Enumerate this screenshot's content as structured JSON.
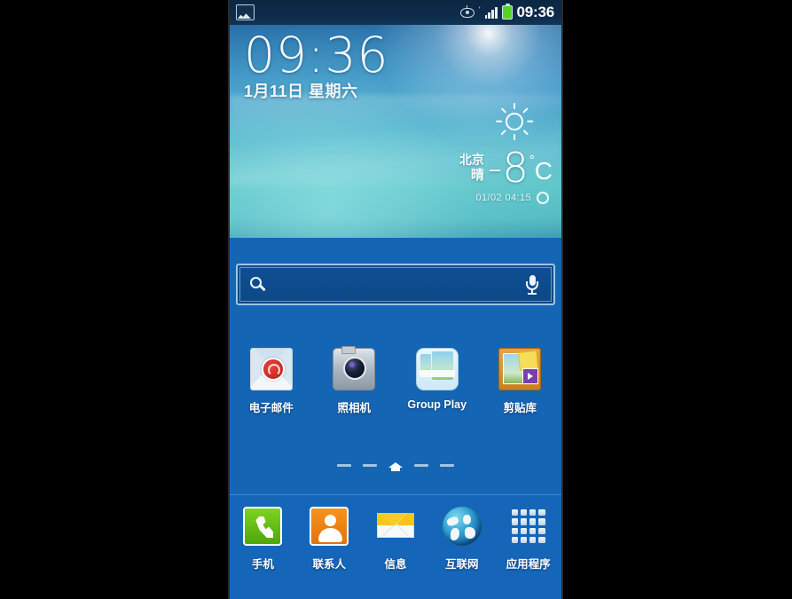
{
  "status_bar": {
    "notification_icon": "gallery-icon",
    "icons": [
      "eye-icon",
      "tick-icon",
      "signal-icon",
      "battery-icon"
    ],
    "clock": "09:36"
  },
  "clock_widget": {
    "time": "09:36",
    "date": "1月11日 星期六"
  },
  "weather_widget": {
    "icon": "sun-icon",
    "city": "北京",
    "condition": "晴",
    "temperature": "-8",
    "degree_symbol": "°",
    "unit": "C",
    "updated": "01/02 04:15",
    "refresh_icon": "refresh-icon"
  },
  "search": {
    "value": "",
    "placeholder": "",
    "search_icon": "search-icon",
    "voice_icon": "microphone-icon"
  },
  "apps": [
    {
      "label": "电子邮件",
      "icon": "email-icon"
    },
    {
      "label": "照相机",
      "icon": "camera-icon"
    },
    {
      "label": "Group Play",
      "icon": "group-play-icon"
    },
    {
      "label": "剪贴库",
      "icon": "scrapbook-icon"
    }
  ],
  "pager": {
    "pages": 5,
    "current_index": 2,
    "home_icon": "home-icon"
  },
  "dock": [
    {
      "label": "手机",
      "icon": "phone-icon"
    },
    {
      "label": "联系人",
      "icon": "contacts-icon"
    },
    {
      "label": "信息",
      "icon": "messages-icon"
    },
    {
      "label": "互联网",
      "icon": "globe-icon"
    },
    {
      "label": "应用程序",
      "icon": "apps-grid-icon"
    }
  ],
  "highlight": {
    "target": "应用程序",
    "color": "#f01313"
  },
  "colors": {
    "home_background": "#1565b5",
    "dock_background": "#1566b8",
    "status_bar": "#0d2b49",
    "accent_red": "#f01313",
    "battery_green": "#55d321"
  }
}
